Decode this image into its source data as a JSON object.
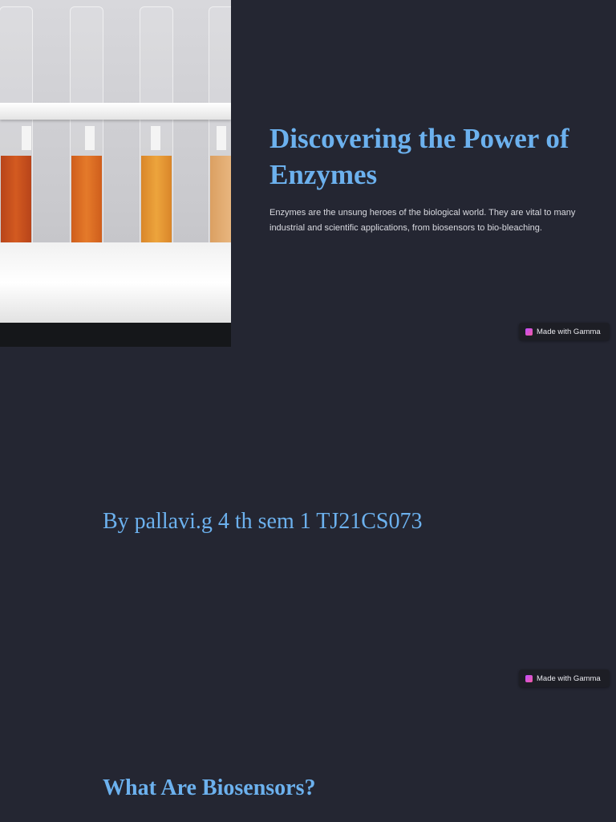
{
  "slide1": {
    "title": "Discovering the Power of Enzymes",
    "description": "Enzymes are the unsung heroes of the biological world. They are vital to many industrial and scientific applications, from biosensors to bio-bleaching.",
    "badge": "Made with Gamma",
    "liquid_colors": [
      "#c8501a",
      "#d9691f",
      "#e0952e",
      "#e3b07a"
    ]
  },
  "slide2": {
    "author": "By pallavi.g 4 th sem 1 TJ21CS073",
    "badge": "Made with Gamma"
  },
  "slide3": {
    "title": "What Are Biosensors?"
  }
}
